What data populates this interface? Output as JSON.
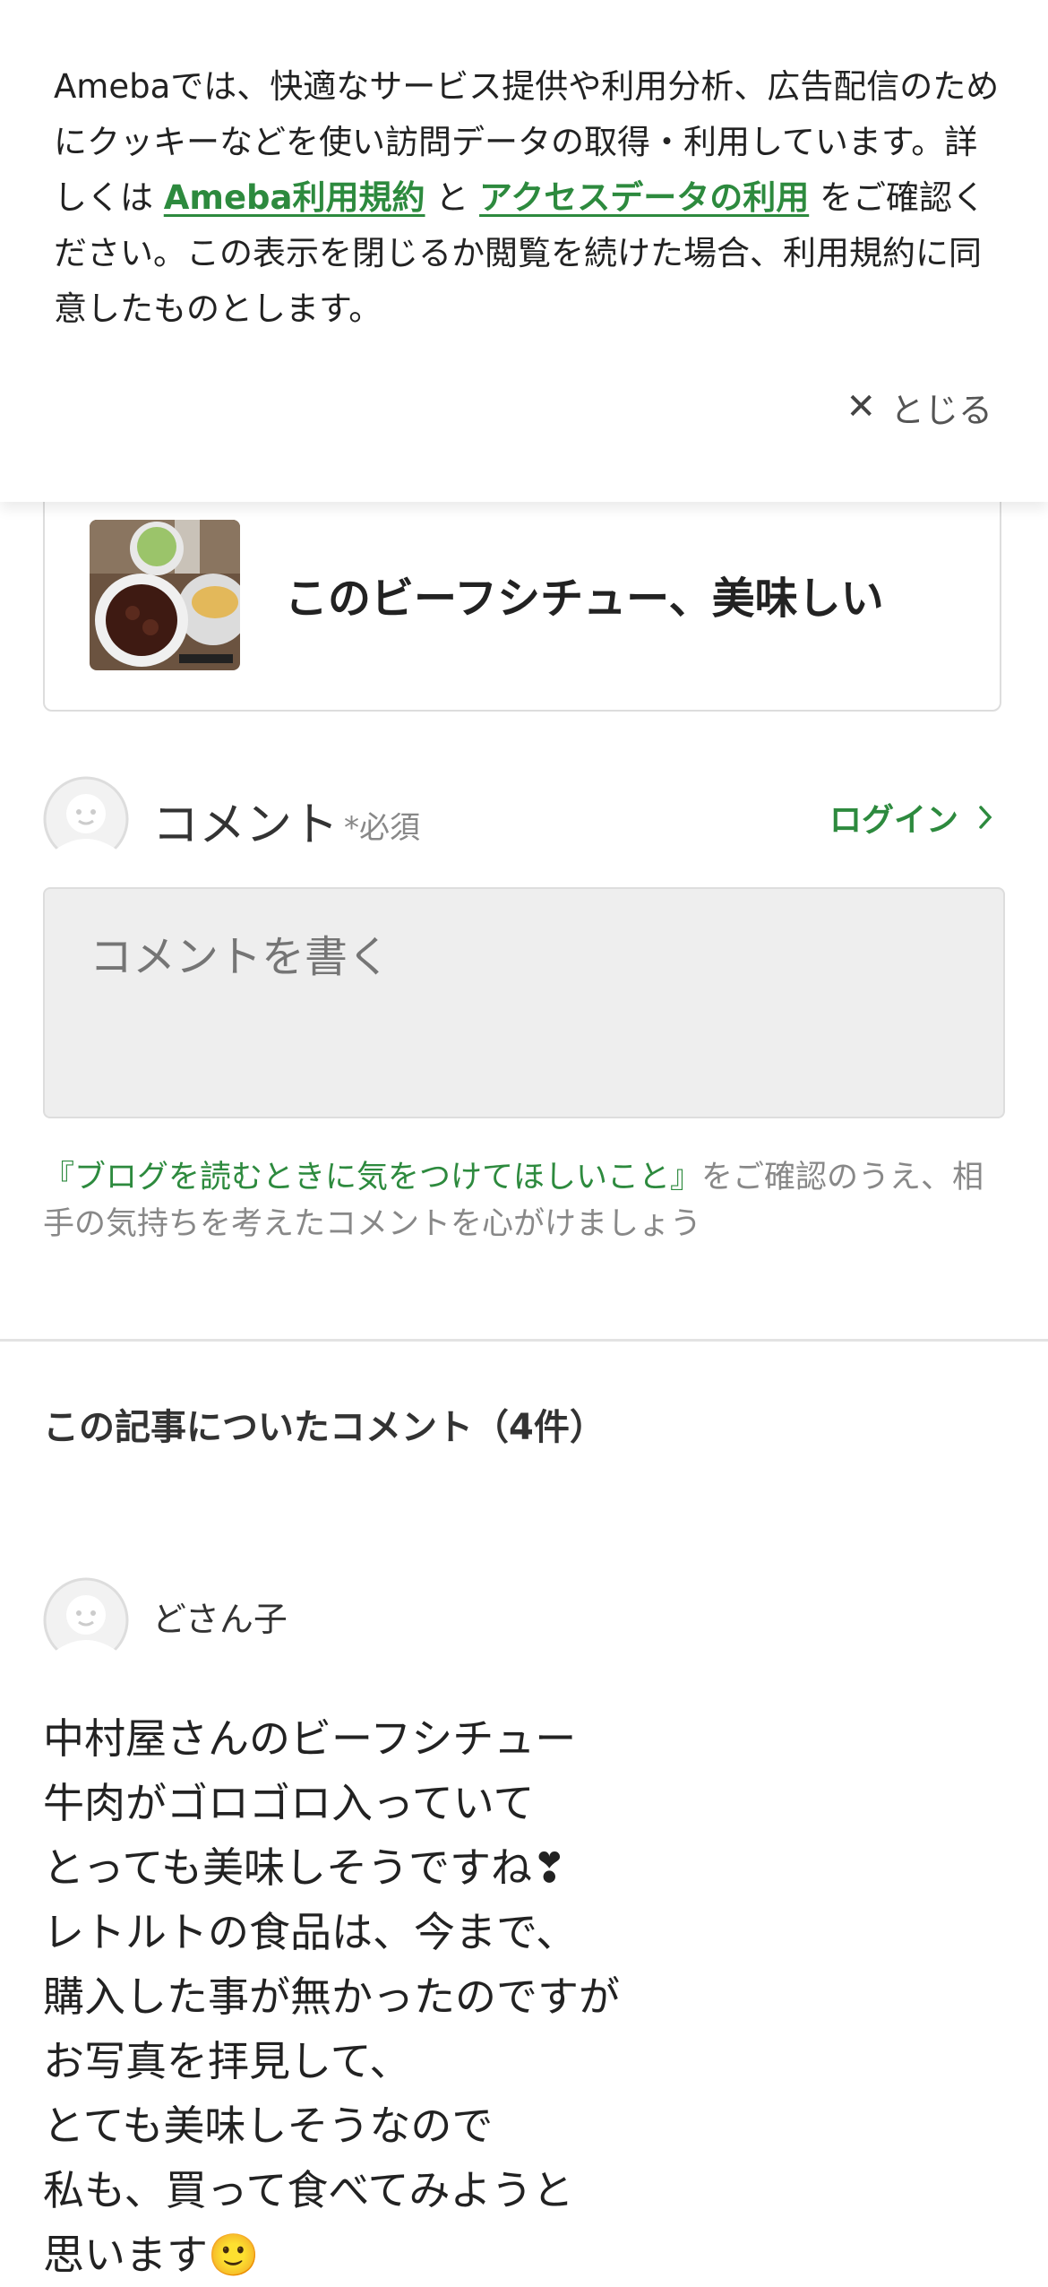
{
  "cookie_banner": {
    "text_1": "Amebaでは、快適なサービス提供や利用分析、広告配信のためにクッキーなどを使い訪問データの取得・利用しています。詳しくは ",
    "terms_link": "Ameba利用規約",
    "text_2": " と ",
    "access_link": "アクセスデータの利用",
    "text_3": " をご確認ください。この表示を閉じるか閲覧を続けた場合、利用規約に同意したものとします。",
    "close_label": "とじる",
    "close_icon": "close-icon"
  },
  "article": {
    "title": "このビーフシチュー、美味しい",
    "thumbnail_icon": "food-photo"
  },
  "comment_form": {
    "label": "コメント",
    "required": "*必須",
    "login_label": "ログイン",
    "placeholder": "コメントを書く",
    "notice_link": "『ブログを読むときに気をつけてほしいこと』",
    "notice_text": "をご確認のうえ、相手の気持ちを考えたコメントを心がけましょう"
  },
  "comments": {
    "section_title": "この記事についたコメント（4件）",
    "items": [
      {
        "author": "どさん子",
        "lines": [
          "中村屋さんのビーフシチュー",
          "牛肉がゴロゴロ入っていて",
          "とっても美味しそうですね❣",
          "レトルトの食品は、今まで、",
          "購入した事が無かったのですが",
          "お写真を拝見して、",
          "とても美味しそうなので",
          "私も、買って食べてみようと",
          "思います🙂"
        ]
      }
    ]
  },
  "colors": {
    "accent": "#2d8a3e",
    "muted": "#888888",
    "border": "#dddddd"
  }
}
